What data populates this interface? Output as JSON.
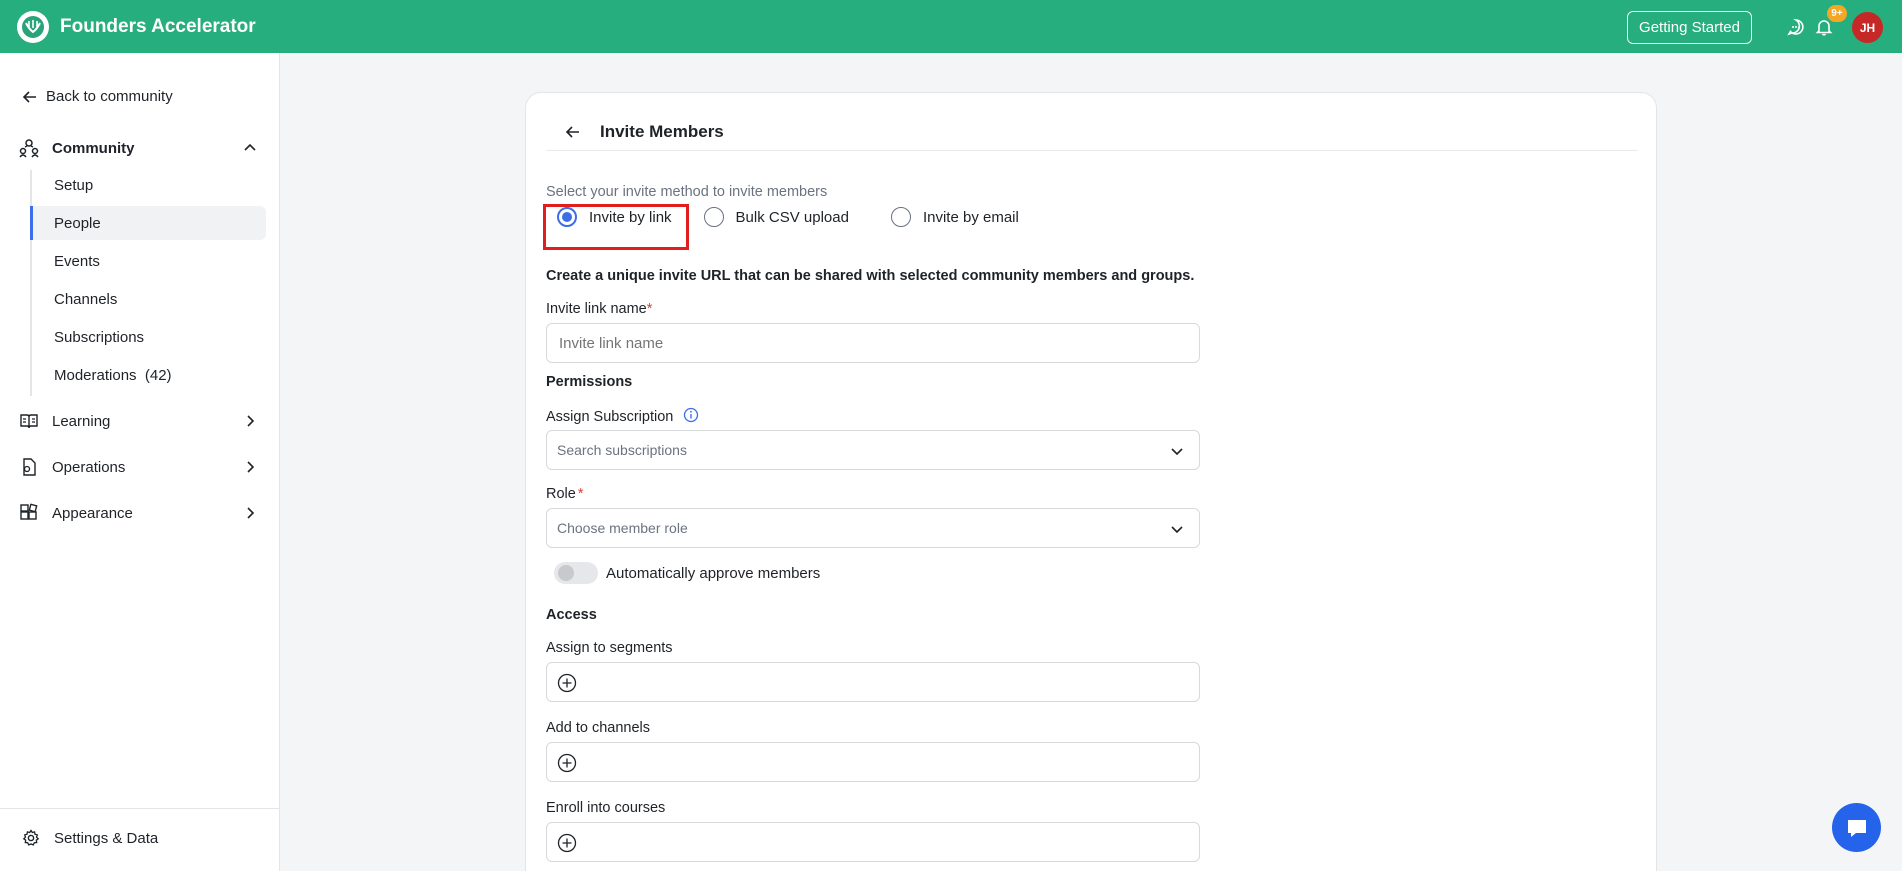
{
  "header": {
    "app_title": "Founders Accelerator",
    "getting_started": "Getting Started",
    "notification_badge": "9+",
    "avatar_initials": "JH",
    "brand_color": "#27ae7f"
  },
  "sidebar": {
    "back_label": "Back to community",
    "community_label": "Community",
    "community_items": [
      {
        "label": "Setup"
      },
      {
        "label": "People"
      },
      {
        "label": "Events"
      },
      {
        "label": "Channels"
      },
      {
        "label": "Subscriptions"
      },
      {
        "label": "Moderations  (42)"
      }
    ],
    "learning_label": "Learning",
    "operations_label": "Operations",
    "appearance_label": "Appearance",
    "settings_label": "Settings & Data"
  },
  "form": {
    "title": "Invite Members",
    "method_prompt": "Select your invite method to invite members",
    "methods": [
      {
        "label": "Invite by link"
      },
      {
        "label": "Bulk CSV upload"
      },
      {
        "label": "Invite by email"
      }
    ],
    "description": "Create a unique invite URL that can be shared with selected community members and groups.",
    "link_name_label": "Invite link name",
    "required_mark": "*",
    "link_name_placeholder": "Invite link name",
    "permissions_title": "Permissions",
    "assign_subscription_label": "Assign Subscription",
    "subscription_placeholder": "Search subscriptions",
    "role_label": "Role",
    "role_placeholder": "Choose member role",
    "auto_approve_label": "Automatically approve members",
    "access_title": "Access",
    "segments_label": "Assign to segments",
    "channels_label": "Add to channels",
    "courses_label": "Enroll into courses"
  }
}
